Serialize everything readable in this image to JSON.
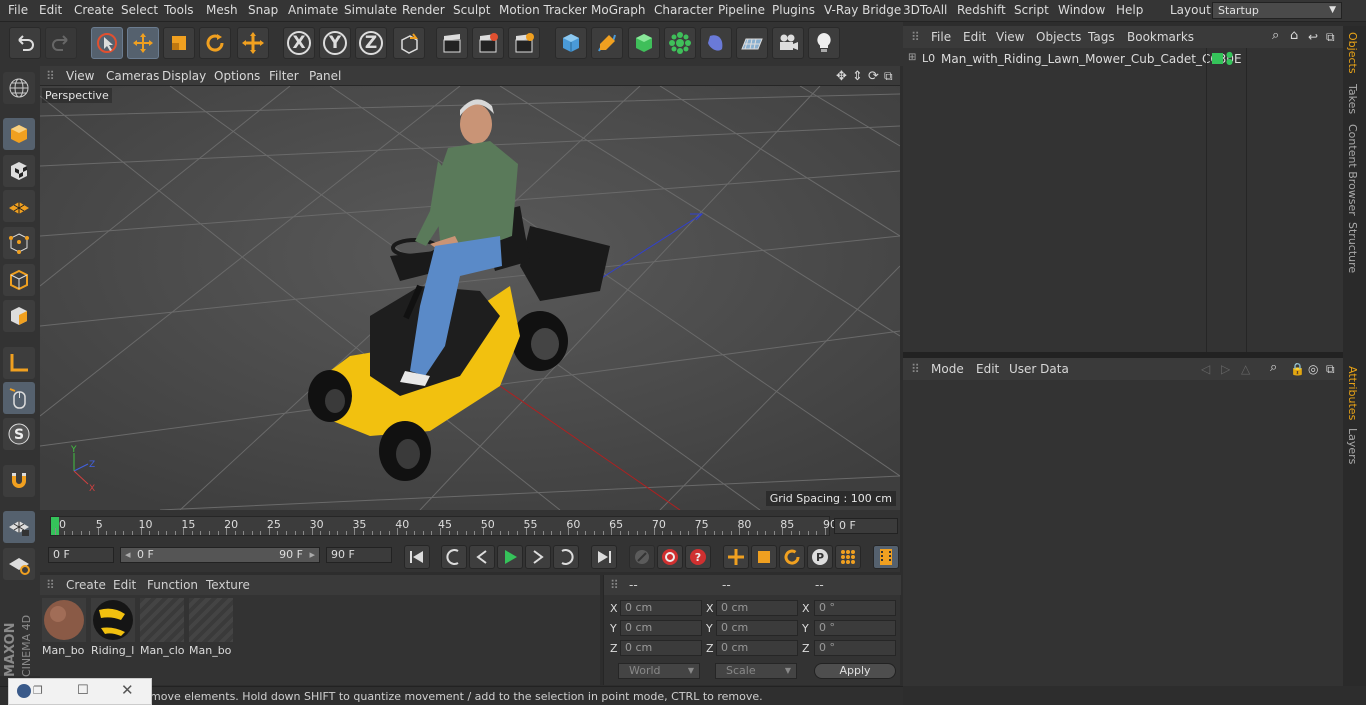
{
  "menubar": {
    "items": [
      "File",
      "Edit",
      "Create",
      "Select",
      "Tools",
      "Mesh",
      "Snap",
      "Animate",
      "Simulate",
      "Render",
      "Sculpt",
      "Motion Tracker",
      "MoGraph",
      "Character",
      "Pipeline",
      "Plugins",
      "V-Ray Bridge",
      "3DToAll",
      "Redshift",
      "Script",
      "Window",
      "Help"
    ],
    "layout_label": "Layout:",
    "layout_value": "Startup"
  },
  "toolbar": {
    "axis_x": "X",
    "axis_y": "Y",
    "axis_z": "Z"
  },
  "viewport": {
    "menu": [
      "View",
      "Cameras",
      "Display",
      "Options",
      "Filter",
      "Panel"
    ],
    "label": "Perspective",
    "grid_spacing": "Grid Spacing : 100 cm"
  },
  "timeline": {
    "labels": [
      "0",
      "5",
      "10",
      "15",
      "20",
      "25",
      "30",
      "35",
      "40",
      "45",
      "50",
      "55",
      "60",
      "65",
      "70",
      "75",
      "80",
      "85",
      "90"
    ],
    "current_frame": "0 F"
  },
  "transport": {
    "start_field": "0 F",
    "range_start": "0 F",
    "range_end": "90 F",
    "end_field": "90 F"
  },
  "materials": {
    "menu": [
      "Create",
      "Edit",
      "Function",
      "Texture"
    ],
    "items": [
      {
        "label": "Man_bo",
        "kind": "skin"
      },
      {
        "label": "Riding_l",
        "kind": "yellow"
      },
      {
        "label": "Man_clo",
        "kind": "empty"
      },
      {
        "label": "Man_bo",
        "kind": "empty"
      }
    ]
  },
  "coordinates": {
    "headers": [
      "--",
      "--",
      "--"
    ],
    "rows": [
      {
        "axis": "X",
        "pos": "0 cm",
        "size": "0 cm",
        "rot": "0 °"
      },
      {
        "axis": "Y",
        "pos": "0 cm",
        "size": "0 cm",
        "rot": "0 °"
      },
      {
        "axis": "Z",
        "pos": "0 cm",
        "size": "0 cm",
        "rot": "0 °"
      }
    ],
    "space": "World",
    "mode": "Scale",
    "apply": "Apply"
  },
  "objects": {
    "menu": [
      "File",
      "Edit",
      "View",
      "Objects",
      "Tags",
      "Bookmarks"
    ],
    "tree": [
      {
        "name": "Man_with_Riding_Lawn_Mower_Cub_Cadet_CC30E"
      }
    ]
  },
  "attributes": {
    "menu": [
      "Mode",
      "Edit",
      "User Data"
    ]
  },
  "sidetabs": {
    "top": [
      "Objects",
      "Takes",
      "Content Browser",
      "Structure"
    ],
    "bottom": [
      "Attributes",
      "Layers"
    ]
  },
  "status": {
    "text": "move elements. Hold down SHIFT to quantize movement / add to the selection in point mode, CTRL to remove."
  },
  "colors": {
    "accent_orange": "#e8a317",
    "active_tool_blue": "#55616e",
    "viewport_bg": "#4b4b4b",
    "mower_yellow": "#f2c10f"
  },
  "brand": "MAXON CINEMA 4D"
}
